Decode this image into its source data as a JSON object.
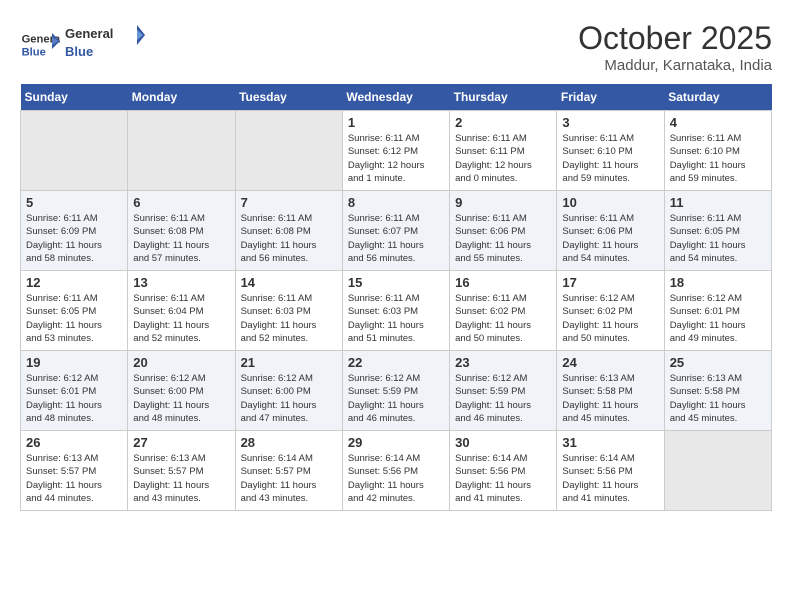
{
  "header": {
    "logo_line1": "General",
    "logo_line2": "Blue",
    "month": "October 2025",
    "location": "Maddur, Karnataka, India"
  },
  "weekdays": [
    "Sunday",
    "Monday",
    "Tuesday",
    "Wednesday",
    "Thursday",
    "Friday",
    "Saturday"
  ],
  "weeks": [
    [
      {
        "day": "",
        "info": ""
      },
      {
        "day": "",
        "info": ""
      },
      {
        "day": "",
        "info": ""
      },
      {
        "day": "1",
        "info": "Sunrise: 6:11 AM\nSunset: 6:12 PM\nDaylight: 12 hours\nand 1 minute."
      },
      {
        "day": "2",
        "info": "Sunrise: 6:11 AM\nSunset: 6:11 PM\nDaylight: 12 hours\nand 0 minutes."
      },
      {
        "day": "3",
        "info": "Sunrise: 6:11 AM\nSunset: 6:10 PM\nDaylight: 11 hours\nand 59 minutes."
      },
      {
        "day": "4",
        "info": "Sunrise: 6:11 AM\nSunset: 6:10 PM\nDaylight: 11 hours\nand 59 minutes."
      }
    ],
    [
      {
        "day": "5",
        "info": "Sunrise: 6:11 AM\nSunset: 6:09 PM\nDaylight: 11 hours\nand 58 minutes."
      },
      {
        "day": "6",
        "info": "Sunrise: 6:11 AM\nSunset: 6:08 PM\nDaylight: 11 hours\nand 57 minutes."
      },
      {
        "day": "7",
        "info": "Sunrise: 6:11 AM\nSunset: 6:08 PM\nDaylight: 11 hours\nand 56 minutes."
      },
      {
        "day": "8",
        "info": "Sunrise: 6:11 AM\nSunset: 6:07 PM\nDaylight: 11 hours\nand 56 minutes."
      },
      {
        "day": "9",
        "info": "Sunrise: 6:11 AM\nSunset: 6:06 PM\nDaylight: 11 hours\nand 55 minutes."
      },
      {
        "day": "10",
        "info": "Sunrise: 6:11 AM\nSunset: 6:06 PM\nDaylight: 11 hours\nand 54 minutes."
      },
      {
        "day": "11",
        "info": "Sunrise: 6:11 AM\nSunset: 6:05 PM\nDaylight: 11 hours\nand 54 minutes."
      }
    ],
    [
      {
        "day": "12",
        "info": "Sunrise: 6:11 AM\nSunset: 6:05 PM\nDaylight: 11 hours\nand 53 minutes."
      },
      {
        "day": "13",
        "info": "Sunrise: 6:11 AM\nSunset: 6:04 PM\nDaylight: 11 hours\nand 52 minutes."
      },
      {
        "day": "14",
        "info": "Sunrise: 6:11 AM\nSunset: 6:03 PM\nDaylight: 11 hours\nand 52 minutes."
      },
      {
        "day": "15",
        "info": "Sunrise: 6:11 AM\nSunset: 6:03 PM\nDaylight: 11 hours\nand 51 minutes."
      },
      {
        "day": "16",
        "info": "Sunrise: 6:11 AM\nSunset: 6:02 PM\nDaylight: 11 hours\nand 50 minutes."
      },
      {
        "day": "17",
        "info": "Sunrise: 6:12 AM\nSunset: 6:02 PM\nDaylight: 11 hours\nand 50 minutes."
      },
      {
        "day": "18",
        "info": "Sunrise: 6:12 AM\nSunset: 6:01 PM\nDaylight: 11 hours\nand 49 minutes."
      }
    ],
    [
      {
        "day": "19",
        "info": "Sunrise: 6:12 AM\nSunset: 6:01 PM\nDaylight: 11 hours\nand 48 minutes."
      },
      {
        "day": "20",
        "info": "Sunrise: 6:12 AM\nSunset: 6:00 PM\nDaylight: 11 hours\nand 48 minutes."
      },
      {
        "day": "21",
        "info": "Sunrise: 6:12 AM\nSunset: 6:00 PM\nDaylight: 11 hours\nand 47 minutes."
      },
      {
        "day": "22",
        "info": "Sunrise: 6:12 AM\nSunset: 5:59 PM\nDaylight: 11 hours\nand 46 minutes."
      },
      {
        "day": "23",
        "info": "Sunrise: 6:12 AM\nSunset: 5:59 PM\nDaylight: 11 hours\nand 46 minutes."
      },
      {
        "day": "24",
        "info": "Sunrise: 6:13 AM\nSunset: 5:58 PM\nDaylight: 11 hours\nand 45 minutes."
      },
      {
        "day": "25",
        "info": "Sunrise: 6:13 AM\nSunset: 5:58 PM\nDaylight: 11 hours\nand 45 minutes."
      }
    ],
    [
      {
        "day": "26",
        "info": "Sunrise: 6:13 AM\nSunset: 5:57 PM\nDaylight: 11 hours\nand 44 minutes."
      },
      {
        "day": "27",
        "info": "Sunrise: 6:13 AM\nSunset: 5:57 PM\nDaylight: 11 hours\nand 43 minutes."
      },
      {
        "day": "28",
        "info": "Sunrise: 6:14 AM\nSunset: 5:57 PM\nDaylight: 11 hours\nand 43 minutes."
      },
      {
        "day": "29",
        "info": "Sunrise: 6:14 AM\nSunset: 5:56 PM\nDaylight: 11 hours\nand 42 minutes."
      },
      {
        "day": "30",
        "info": "Sunrise: 6:14 AM\nSunset: 5:56 PM\nDaylight: 11 hours\nand 41 minutes."
      },
      {
        "day": "31",
        "info": "Sunrise: 6:14 AM\nSunset: 5:56 PM\nDaylight: 11 hours\nand 41 minutes."
      },
      {
        "day": "",
        "info": ""
      }
    ]
  ]
}
